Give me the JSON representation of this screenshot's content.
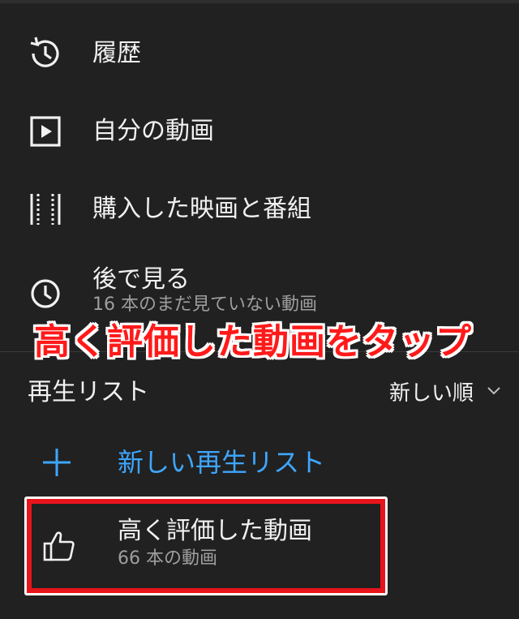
{
  "menu": {
    "items": [
      {
        "id": "history",
        "label": "履歴",
        "icon": "history-icon"
      },
      {
        "id": "my-videos",
        "label": "自分の動画",
        "icon": "play-square-icon"
      },
      {
        "id": "purchases",
        "label": "購入した映画と番組",
        "icon": "film-strip-icon"
      },
      {
        "id": "watch-later",
        "label": "後で見る",
        "subtitle": "16 本のまだ見ていない動画",
        "icon": "clock-icon"
      }
    ]
  },
  "annotation": {
    "text": "高く評価した動画をタップ",
    "color": "#ff1a1a",
    "outline_color": "#ffffff"
  },
  "playlists": {
    "title": "再生リスト",
    "sort_label": "新しい順",
    "sort_icon": "chevron-down-icon",
    "new_playlist_label": "新しい再生リスト",
    "new_playlist_icon": "plus-icon",
    "accent_color": "#3ea6ff",
    "items": [
      {
        "label": "高く評価した動画",
        "subtitle": "66 本の動画",
        "icon": "thumbs-up-icon"
      }
    ]
  },
  "highlight": {
    "color": "#e8141b"
  }
}
